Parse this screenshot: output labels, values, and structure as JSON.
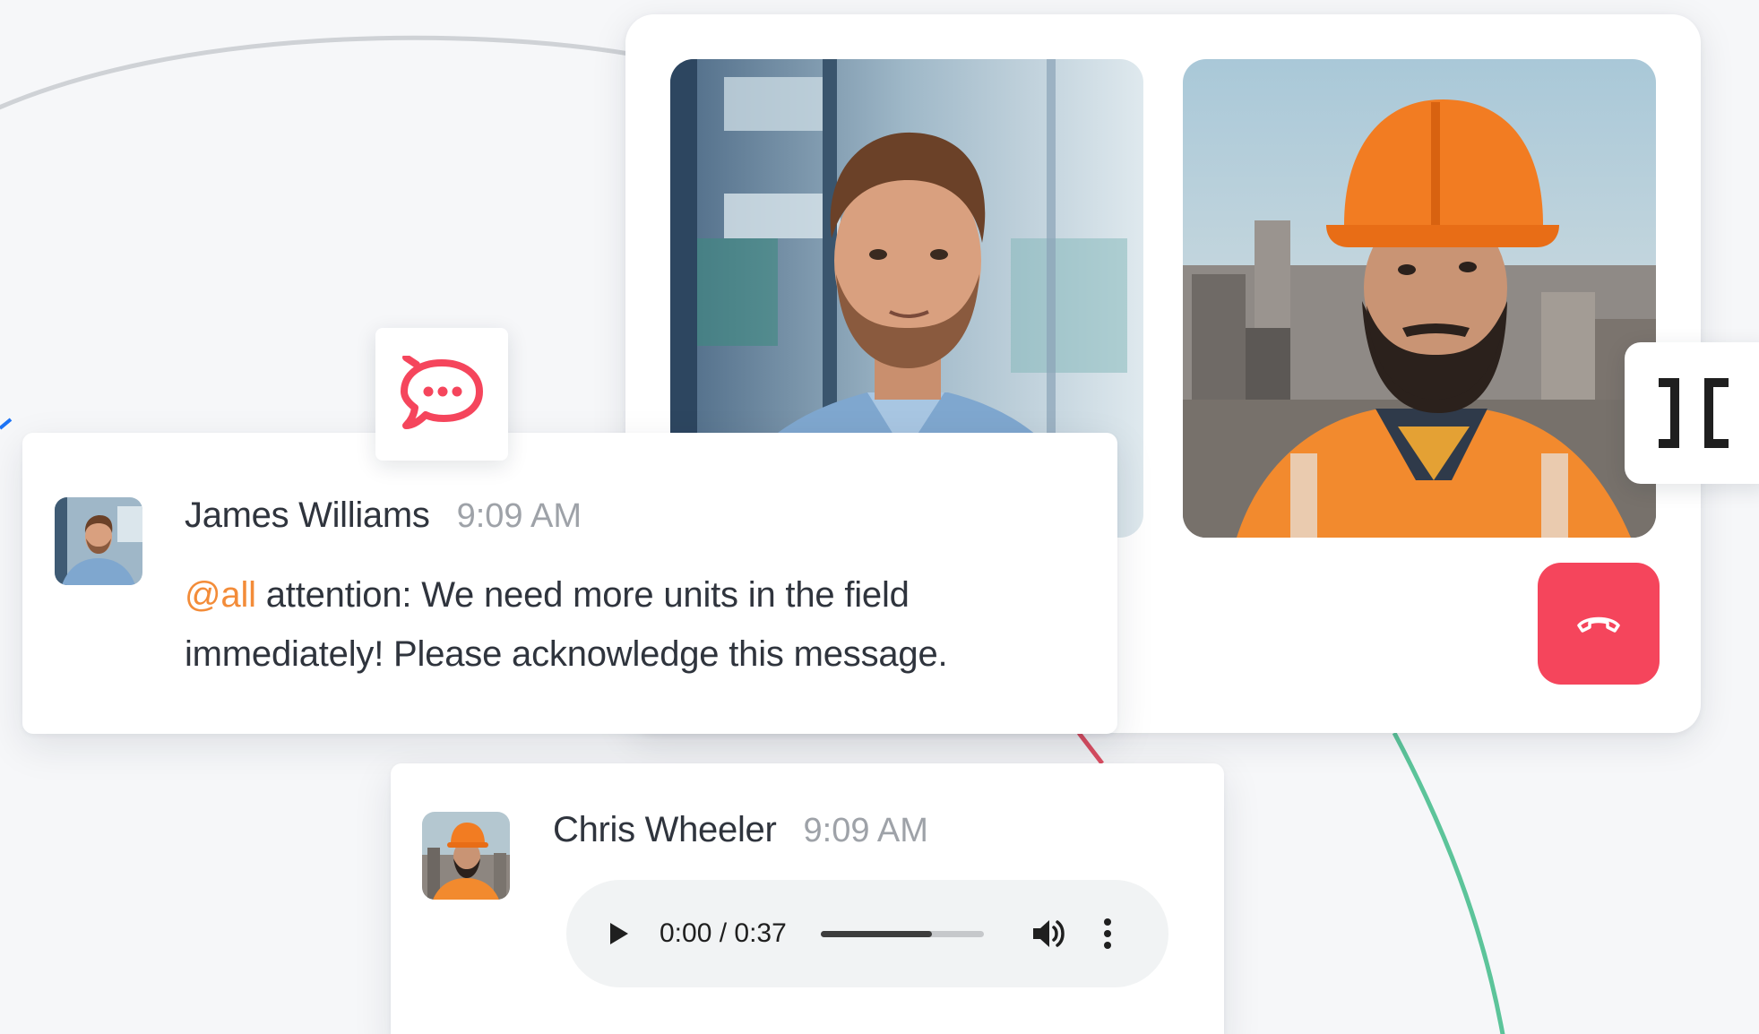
{
  "call": {
    "participants": [
      {
        "name": "James Williams",
        "photo": "man-in-denim-shirt-office"
      },
      {
        "name": "Chris Wheeler",
        "photo": "worker-in-hard-hat-city"
      }
    ],
    "end_call_icon": "phone-hangup-icon",
    "end_call_color": "#f5455c",
    "side_tab_icon": "collapse-brackets-icon"
  },
  "logo": {
    "icon": "rocket-chat-logo-icon",
    "color": "#f5455c"
  },
  "messages": [
    {
      "sender": "James Williams",
      "time": "9:09 AM",
      "mention": "@all",
      "text": " attention: We need more units in the field immediately! Please acknowledge this message.",
      "mention_color": "#f38c39"
    },
    {
      "sender": "Chris Wheeler",
      "time": "9:09 AM",
      "audio": {
        "time_display": "0:00 / 0:37",
        "progress": 0.68,
        "play_icon": "play-icon",
        "volume_icon": "volume-icon",
        "more_icon": "more-vertical-icon"
      }
    }
  ],
  "colors": {
    "background": "#f6f7f9",
    "text": "#2f343d",
    "muted": "#9ea2a8",
    "curve_gray": "#cfd2d6",
    "curve_blue": "#1d74f5",
    "curve_red": "#e05064",
    "curve_green": "#5cc49a"
  }
}
